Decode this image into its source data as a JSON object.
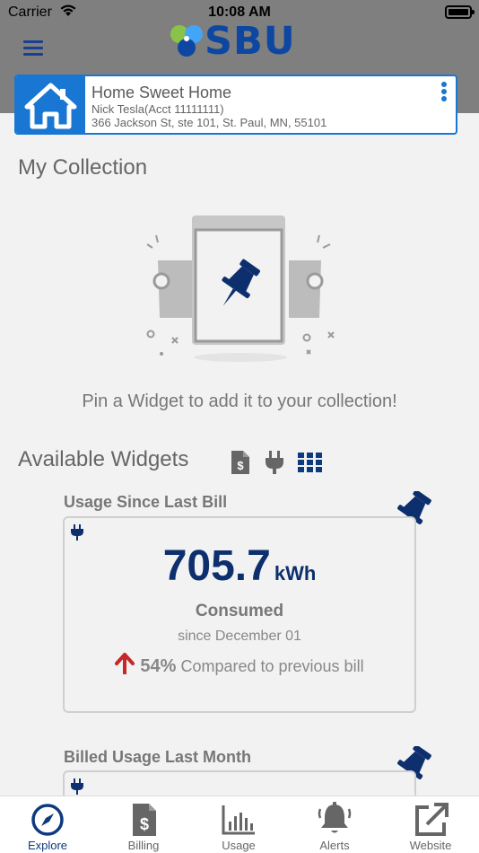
{
  "status_bar": {
    "carrier": "Carrier",
    "time": "10:08 AM"
  },
  "logo": {
    "text": "SBU"
  },
  "account": {
    "name": "Home Sweet Home",
    "account_line": "Nick Tesla(Acct 11111111)",
    "address": "366 Jackson St, ste 101, St. Paul, MN, 55101"
  },
  "collection": {
    "title": "My Collection",
    "empty_message": "Pin a Widget to add it to your collection!"
  },
  "available": {
    "title": "Available Widgets",
    "filters": [
      "billing-document-icon",
      "plug-icon",
      "grid-icon"
    ],
    "active_filter": "grid-icon"
  },
  "widgets": [
    {
      "title": "Usage Since Last Bill",
      "value": "705.7",
      "unit": "kWh",
      "label": "Consumed",
      "since": "since December 01",
      "change_pct": "54%",
      "change_text": "Compared to previous bill",
      "change_direction": "up"
    },
    {
      "title": "Billed Usage Last Month"
    }
  ],
  "tabs": [
    {
      "label": "Explore",
      "icon": "compass-icon",
      "active": true
    },
    {
      "label": "Billing",
      "icon": "bill-icon",
      "active": false
    },
    {
      "label": "Usage",
      "icon": "bar-chart-icon",
      "active": false
    },
    {
      "label": "Alerts",
      "icon": "bell-icon",
      "active": false
    },
    {
      "label": "Website",
      "icon": "external-link-icon",
      "active": false
    }
  ],
  "colors": {
    "header_bg": "#7f7f7f",
    "primary": "#1976d2",
    "navy": "#0d3a7e",
    "arrow_up": "#c62828"
  }
}
